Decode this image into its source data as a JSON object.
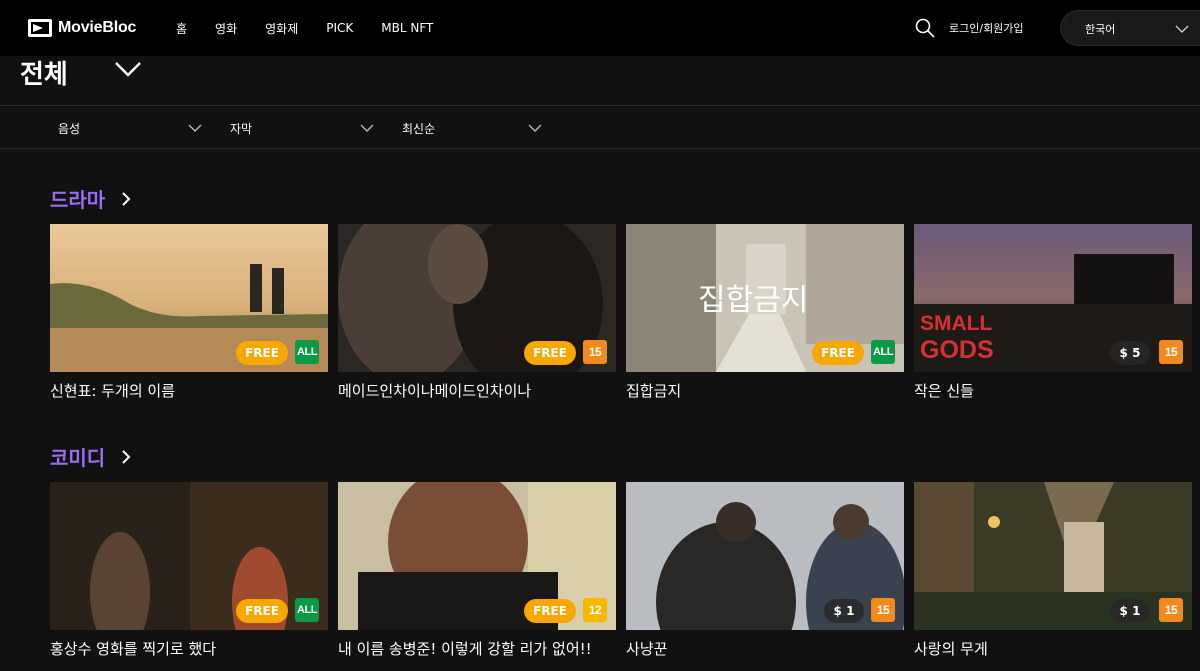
{
  "header": {
    "logo_text": "MovieBloc",
    "nav": [
      "홈",
      "영화",
      "영화제",
      "PICK",
      "MBL NFT"
    ],
    "login_label": "로그인/회원가입",
    "language": "한국어"
  },
  "category": {
    "title": "전체"
  },
  "filters": {
    "audio": "음성",
    "subtitle": "자막",
    "sort": "최신순"
  },
  "sections": [
    {
      "title": "드라마",
      "items": [
        {
          "title": "신현표: 두개의 이름",
          "price": "FREE",
          "rating": "ALL"
        },
        {
          "title": "메이드인차이나메이드인차이나",
          "price": "FREE",
          "rating": "15"
        },
        {
          "title": "집합금지",
          "price": "FREE",
          "rating": "ALL",
          "poster_text": "집합금지"
        },
        {
          "title": "작은 신들",
          "price": "$ 5",
          "rating": "15",
          "poster_text_1": "SMALL",
          "poster_text_2": "GODS"
        }
      ]
    },
    {
      "title": "코미디",
      "items": [
        {
          "title": "홍상수 영화를 찍기로 했다",
          "price": "FREE",
          "rating": "ALL"
        },
        {
          "title": "내 이름 송병준! 이렇게 강할 리가 없어!!",
          "price": "FREE",
          "rating": "12"
        },
        {
          "title": "사냥꾼",
          "price": "$ 1",
          "rating": "15"
        },
        {
          "title": "사랑의 무게",
          "price": "$ 1",
          "rating": "15"
        }
      ]
    }
  ],
  "colors": {
    "accent": "#9b6cf4",
    "free_badge": "#f7a700",
    "rating_all": "#0a9a45",
    "rating_15": "#f08a1c",
    "rating_12": "#f5b700",
    "background": "#111111"
  }
}
